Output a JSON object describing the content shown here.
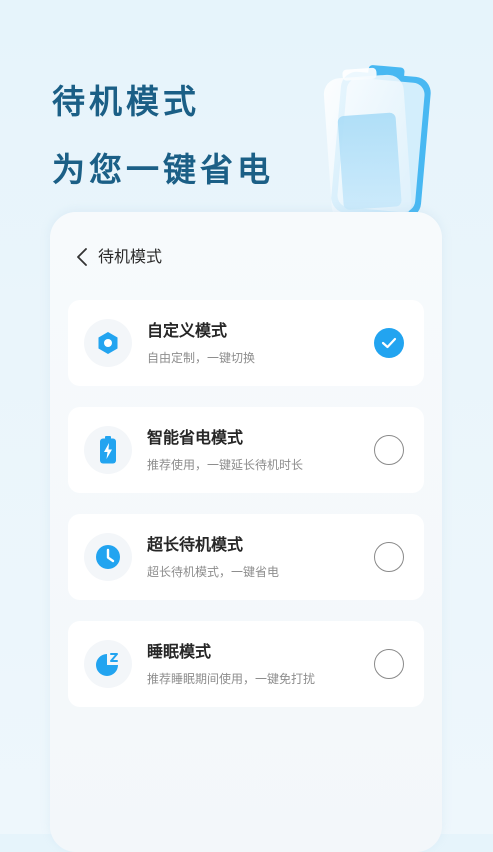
{
  "hero": {
    "line1": "待机模式",
    "line2": "为您一键省电"
  },
  "panel": {
    "title": "待机模式",
    "back_icon": "chevron-left-icon"
  },
  "modes": [
    {
      "name": "自定义模式",
      "desc": "自由定制，一键切换",
      "icon": "hexagon-settings-icon",
      "selected": true
    },
    {
      "name": "智能省电模式",
      "desc": "推荐使用，一键延长待机时长",
      "icon": "battery-charging-icon",
      "selected": false
    },
    {
      "name": "超长待机模式",
      "desc": "超长待机模式，一键省电",
      "icon": "clock-icon",
      "selected": false
    },
    {
      "name": "睡眠模式",
      "desc": "推荐睡眠期间使用，一键免打扰",
      "icon": "moon-sleep-icon",
      "selected": false
    }
  ],
  "colors": {
    "accent": "#22a4f0",
    "hero_text": "#1b5f86"
  }
}
